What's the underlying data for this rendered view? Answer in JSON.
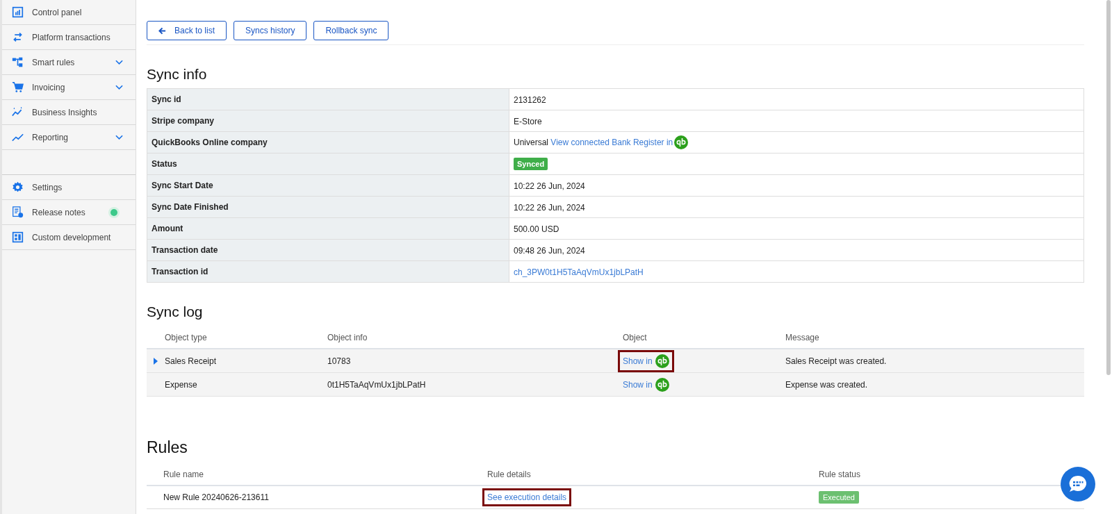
{
  "sidebar": {
    "groups": [
      [
        {
          "label": "Control panel",
          "expandable": false,
          "has_update": false
        },
        {
          "label": "Platform transactions",
          "expandable": false,
          "has_update": false
        },
        {
          "label": "Smart rules",
          "expandable": true,
          "has_update": false
        },
        {
          "label": "Invoicing",
          "expandable": true,
          "has_update": false
        },
        {
          "label": "Business Insights",
          "expandable": false,
          "has_update": false
        },
        {
          "label": "Reporting",
          "expandable": true,
          "has_update": false
        }
      ],
      [
        {
          "label": "Settings",
          "expandable": false,
          "has_update": false
        },
        {
          "label": "Release notes",
          "expandable": false,
          "has_update": true
        },
        {
          "label": "Custom development",
          "expandable": false,
          "has_update": false
        }
      ]
    ]
  },
  "toolbar": {
    "buttons": [
      {
        "label": "Back to list",
        "kind": "back"
      },
      {
        "label": "Syncs history",
        "kind": "plain"
      },
      {
        "label": "Rollback sync",
        "kind": "plain"
      }
    ]
  },
  "sync_info": {
    "title": "Sync info",
    "rows": [
      {
        "label": "Sync id",
        "kind": "text",
        "value": "2131262"
      },
      {
        "label": "Stripe company",
        "kind": "text",
        "value": "E-Store"
      },
      {
        "label": "QuickBooks Online company",
        "kind": "mixed",
        "value": "Universal",
        "link": "View connected Bank Register in"
      },
      {
        "label": "Status",
        "kind": "badge",
        "value": "Synced"
      },
      {
        "label": "Sync Start Date",
        "kind": "text",
        "value": "10:22 26 Jun, 2024"
      },
      {
        "label": "Sync Date Finished",
        "kind": "text",
        "value": "10:22 26 Jun, 2024"
      },
      {
        "label": "Amount",
        "kind": "text",
        "value": "500.00 USD"
      },
      {
        "label": "Transaction date",
        "kind": "text",
        "value": "09:48 26 Jun, 2024"
      },
      {
        "label": "Transaction id",
        "kind": "link",
        "value": "ch_3PW0t1H5TaAqVmUx1jbLPatH"
      }
    ]
  },
  "sync_log": {
    "title": "Sync log",
    "columns": [
      "Object type",
      "Object info",
      "Object",
      "Message"
    ],
    "rows": [
      {
        "selected": true,
        "object_type": "Sales Receipt",
        "object_info": "10783",
        "object": "Show in",
        "highlighted": true,
        "message": "Sales Receipt was created."
      },
      {
        "selected": false,
        "object_type": "Expense",
        "object_info": "0t1H5TaAqVmUx1jbLPatH",
        "object": "Show in",
        "highlighted": false,
        "message": "Expense was created."
      }
    ]
  },
  "rules": {
    "title": "Rules",
    "columns": [
      "Rule name",
      "Rule details",
      "Rule status"
    ],
    "rows": [
      {
        "name": "New Rule 20240626-213611",
        "details": "See execution details",
        "highlighted": true,
        "status": "Executed"
      }
    ]
  }
}
